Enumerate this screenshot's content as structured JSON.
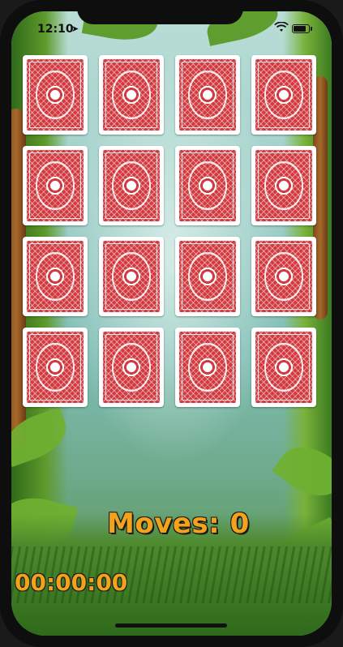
{
  "status_bar": {
    "time": "12:10",
    "location_icon": "location-arrow-icon",
    "wifi_icon": "wifi-icon",
    "battery_icon": "battery-icon"
  },
  "game": {
    "rows": 4,
    "columns": 4,
    "card_back_color": "#d23a3f",
    "cards": [
      {
        "state": "face-down"
      },
      {
        "state": "face-down"
      },
      {
        "state": "face-down"
      },
      {
        "state": "face-down"
      },
      {
        "state": "face-down"
      },
      {
        "state": "face-down"
      },
      {
        "state": "face-down"
      },
      {
        "state": "face-down"
      },
      {
        "state": "face-down"
      },
      {
        "state": "face-down"
      },
      {
        "state": "face-down"
      },
      {
        "state": "face-down"
      },
      {
        "state": "face-down"
      },
      {
        "state": "face-down"
      },
      {
        "state": "face-down"
      },
      {
        "state": "face-down"
      }
    ],
    "moves_text": "Moves: 0",
    "timer_text": "00:00:00",
    "accent_color": "#f3a21b"
  }
}
